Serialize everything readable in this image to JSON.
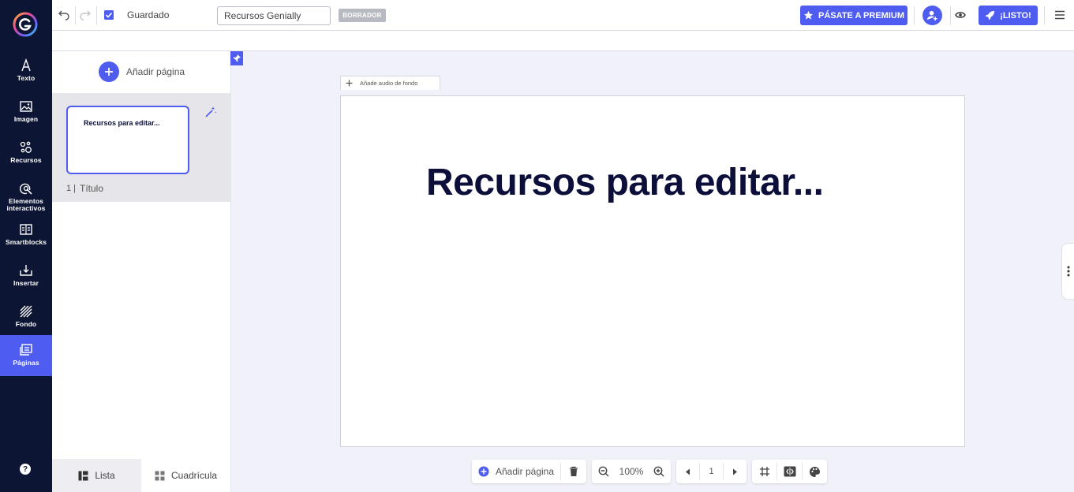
{
  "sidebar": {
    "items": [
      {
        "label": "Texto",
        "icon": "text-icon"
      },
      {
        "label": "Imagen",
        "icon": "image-icon"
      },
      {
        "label": "Recursos",
        "icon": "resources-icon"
      },
      {
        "label": "Elementos interactivos",
        "icon": "interactive-elements-icon"
      },
      {
        "label": "Smartblocks",
        "icon": "smartblocks-icon"
      },
      {
        "label": "Insertar",
        "icon": "insert-icon"
      },
      {
        "label": "Fondo",
        "icon": "background-icon"
      },
      {
        "label": "Páginas",
        "icon": "pages-icon",
        "active": true
      }
    ],
    "help_label": "?"
  },
  "topbar": {
    "saved_label": "Guardado",
    "document_title": "Recursos Genially",
    "draft_badge": "BORRADOR",
    "premium_button": "PÁSATE A PREMIUM",
    "done_button": "¡LISTO!"
  },
  "pages_panel": {
    "add_page_label": "Añadir página",
    "pages": [
      {
        "number": "1 |",
        "name": "Título",
        "thumb_title": "Recursos para editar..."
      }
    ],
    "list_tab": "Lista",
    "grid_tab": "Cuadrícula"
  },
  "canvas": {
    "audio_button": "Añade audio de fondo",
    "slide_title": "Recursos para editar..."
  },
  "bottom_toolbar": {
    "add_page_label": "Añadir página",
    "zoom": "100%",
    "page_number": "1"
  },
  "colors": {
    "accent": "#4e5cf0",
    "rail": "#0c1533",
    "title_text": "#0b0f3a"
  }
}
